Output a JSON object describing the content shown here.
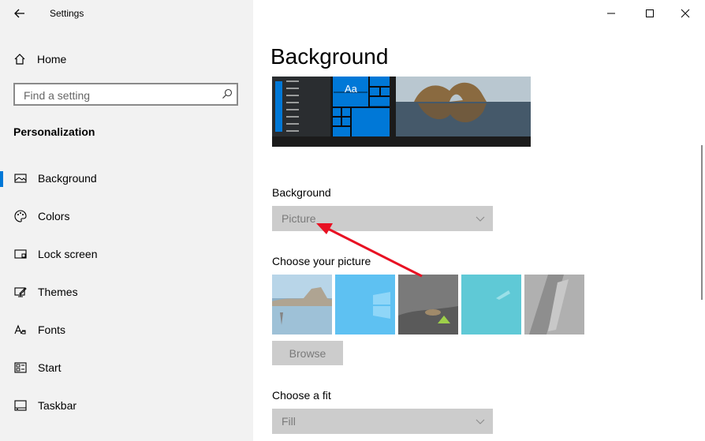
{
  "window": {
    "title": "Settings"
  },
  "sidebar": {
    "home_label": "Home",
    "search_placeholder": "Find a setting",
    "section": "Personalization",
    "items": [
      {
        "label": "Background",
        "icon": "picture-icon",
        "active": true
      },
      {
        "label": "Colors",
        "icon": "palette-icon"
      },
      {
        "label": "Lock screen",
        "icon": "lock-screen-icon"
      },
      {
        "label": "Themes",
        "icon": "themes-icon"
      },
      {
        "label": "Fonts",
        "icon": "fonts-icon"
      },
      {
        "label": "Start",
        "icon": "start-icon"
      },
      {
        "label": "Taskbar",
        "icon": "taskbar-icon"
      }
    ]
  },
  "main": {
    "title": "Background",
    "preview_tile_text": "Aa",
    "background_label": "Background",
    "background_value": "Picture",
    "choose_picture_label": "Choose your picture",
    "browse_label": "Browse",
    "fit_label": "Choose a fit",
    "fit_value": "Fill"
  },
  "colors": {
    "accent": "#0078d7",
    "disabled_bg": "#cccccc",
    "arrow": "#e81123"
  }
}
